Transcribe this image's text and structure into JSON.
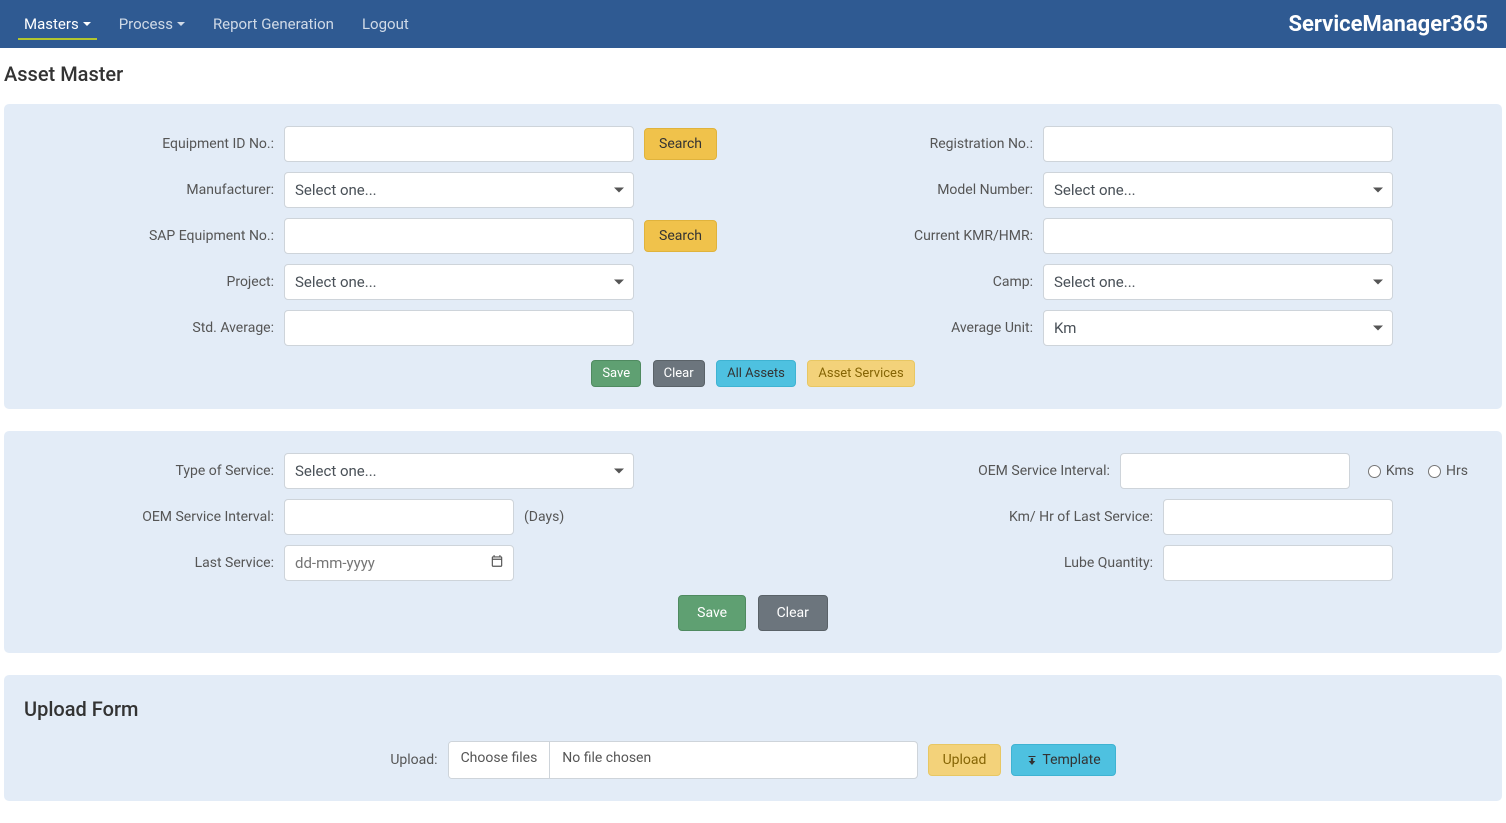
{
  "nav": {
    "items": [
      {
        "label": "Masters",
        "has_caret": true,
        "active": true
      },
      {
        "label": "Process",
        "has_caret": true,
        "active": false
      },
      {
        "label": "Report Generation",
        "has_caret": false,
        "active": false
      },
      {
        "label": "Logout",
        "has_caret": false,
        "active": false
      }
    ],
    "brand": "ServiceManager365"
  },
  "page_title": "Asset Master",
  "panel1": {
    "left": [
      {
        "label": "Equipment ID No.:",
        "type": "text",
        "value": "",
        "has_search": true
      },
      {
        "label": "Manufacturer:",
        "type": "select",
        "value": "Select one...",
        "has_search": false
      },
      {
        "label": "SAP Equipment No.:",
        "type": "text",
        "value": "",
        "has_search": true
      },
      {
        "label": "Project:",
        "type": "select",
        "value": "Select one...",
        "has_search": false
      },
      {
        "label": "Std. Average:",
        "type": "text",
        "value": "",
        "has_search": false
      }
    ],
    "right": [
      {
        "label": "Registration No.:",
        "type": "text",
        "value": ""
      },
      {
        "label": "Model Number:",
        "type": "select",
        "value": "Select one..."
      },
      {
        "label": "Current KMR/HMR:",
        "type": "text",
        "value": ""
      },
      {
        "label": "Camp:",
        "type": "select",
        "value": "Select one..."
      },
      {
        "label": "Average Unit:",
        "type": "select",
        "value": "Km"
      }
    ],
    "buttons": {
      "search": "Search",
      "save": "Save",
      "clear": "Clear",
      "all_assets": "All Assets",
      "asset_services": "Asset Services"
    }
  },
  "panel2": {
    "fields": {
      "type_of_service_label": "Type of Service:",
      "type_of_service_value": "Select one...",
      "oem_interval1_label": "OEM Service Interval:",
      "oem_interval1_value": "",
      "kms_label": "Kms",
      "hrs_label": "Hrs",
      "oem_interval2_label": "OEM Service Interval:",
      "oem_interval2_value": "",
      "days_suffix": "(Days)",
      "km_hr_last_label": "Km/ Hr of Last Service:",
      "km_hr_last_value": "",
      "last_service_label": "Last Service:",
      "last_service_placeholder": "dd-mm-yyyy",
      "lube_qty_label": "Lube Quantity:",
      "lube_qty_value": ""
    },
    "buttons": {
      "save": "Save",
      "clear": "Clear"
    }
  },
  "upload": {
    "title": "Upload Form",
    "upload_label": "Upload:",
    "choose_files": "Choose files",
    "no_file": "No file chosen",
    "upload_btn": "Upload",
    "template_btn": "Template"
  }
}
